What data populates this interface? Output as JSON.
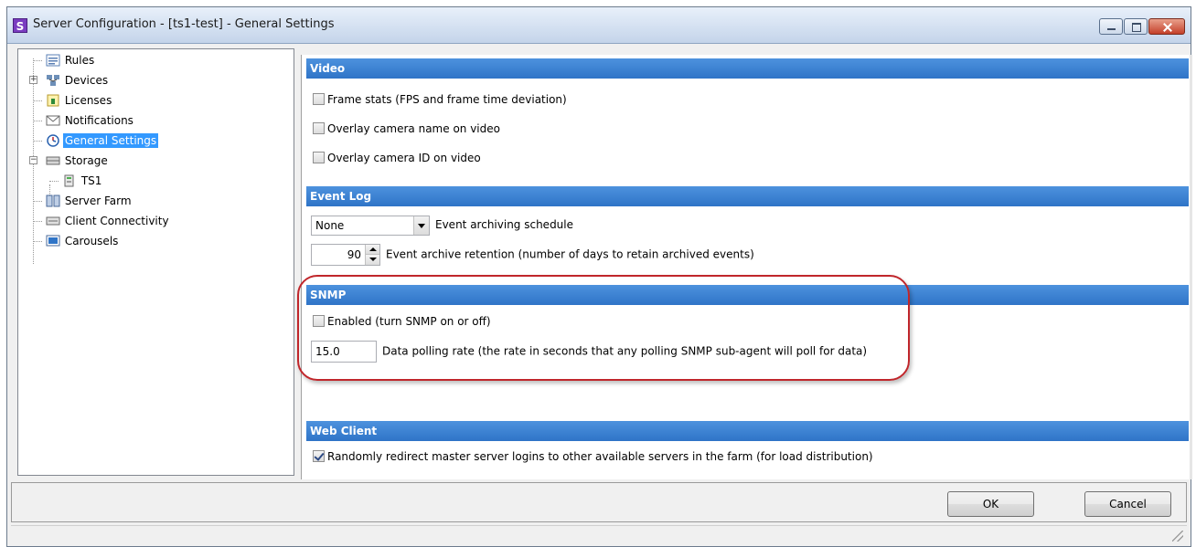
{
  "window": {
    "title": "Server Configuration - [ts1-test] - General Settings",
    "app_icon_letter": "S"
  },
  "tree": {
    "items": [
      {
        "label": "Rules",
        "icon": "rules-icon"
      },
      {
        "label": "Devices",
        "icon": "devices-icon",
        "expander": "+"
      },
      {
        "label": "Licenses",
        "icon": "licenses-icon"
      },
      {
        "label": "Notifications",
        "icon": "envelope-icon"
      },
      {
        "label": "General Settings",
        "icon": "settings-clock-icon",
        "selected": true
      },
      {
        "label": "Storage",
        "icon": "storage-icon",
        "expander": "−"
      },
      {
        "label": "TS1",
        "icon": "server-disk-icon"
      },
      {
        "label": "Server Farm",
        "icon": "server-farm-icon"
      },
      {
        "label": "Client Connectivity",
        "icon": "client-connectivity-icon"
      },
      {
        "label": "Carousels",
        "icon": "carousels-icon"
      }
    ]
  },
  "video": {
    "header": "Video",
    "frame_stats_label": "Frame stats (FPS and frame time deviation)",
    "frame_stats_checked": false,
    "overlay_name_label": "Overlay camera name on video",
    "overlay_name_checked": false,
    "overlay_id_label": "Overlay camera ID on video",
    "overlay_id_checked": false
  },
  "event_log": {
    "header": "Event Log",
    "schedule_value": "None",
    "schedule_label": "Event archiving schedule",
    "retention_value": "90",
    "retention_label": "Event archive retention (number of days to retain archived events)"
  },
  "snmp": {
    "header": "SNMP",
    "enabled_label": "Enabled (turn SNMP on or off)",
    "enabled_checked": false,
    "polling_value": "15.0",
    "polling_label": "Data polling rate (the rate in seconds that any polling SNMP sub-agent will poll for data)"
  },
  "web_client": {
    "header": "Web Client",
    "redirect_label": "Randomly redirect master server logins to other available servers in the farm (for load distribution)",
    "redirect_checked": true
  },
  "buttons": {
    "ok": "OK",
    "cancel": "Cancel"
  },
  "colors": {
    "section_header": "#2f74c7",
    "selection": "#3399ff",
    "highlight_ring": "#c0262b"
  }
}
